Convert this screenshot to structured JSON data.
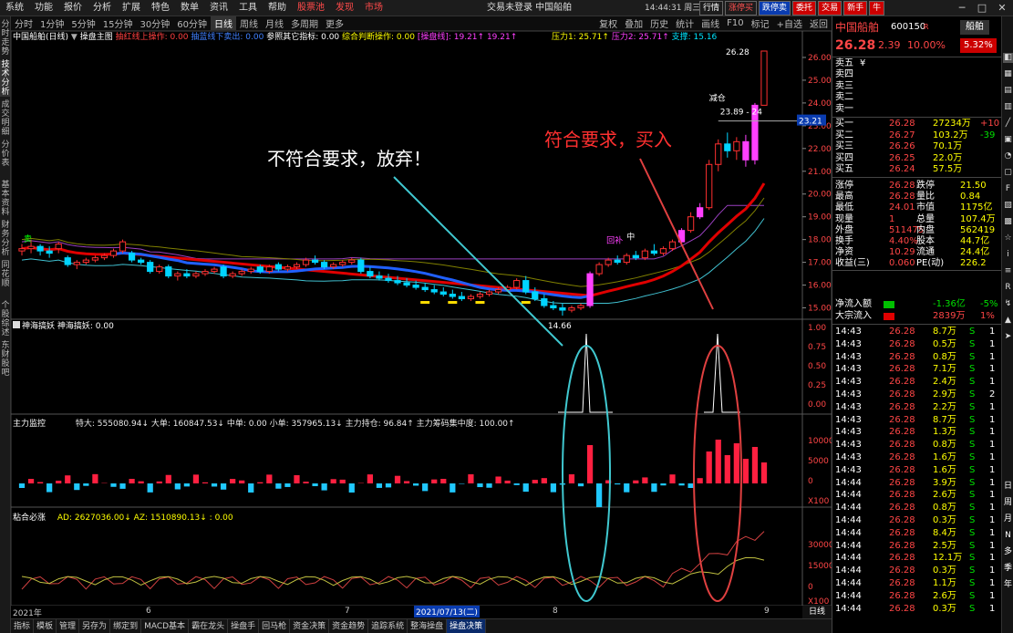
{
  "menubar": {
    "items": [
      "系统",
      "功能",
      "报价",
      "分析",
      "扩展",
      "特色",
      "数单",
      "资讯",
      "工具",
      "帮助"
    ],
    "hot": [
      "股票池",
      "发现",
      "市场"
    ],
    "title": "交易未登录  中国船舶",
    "right_buttons": [
      "行情",
      "涨停买",
      "跌停卖",
      "委托",
      "交易",
      "新手",
      "牛"
    ]
  },
  "left_strip": [
    "分时走势",
    "技术分析",
    "成交明细",
    "分价表",
    "基本资料",
    "财务分析",
    "同花顺",
    "个股综述",
    "东财股吧"
  ],
  "periods": [
    "分时",
    "1分钟",
    "5分钟",
    "15分钟",
    "30分钟",
    "60分钟",
    "日线",
    "周线",
    "月线",
    "多周期",
    "更多"
  ],
  "active_period": "日线",
  "clock": "14:44:31 周三",
  "right_tools": [
    "复权",
    "叠加",
    "历史",
    "统计",
    "画线",
    "F10",
    "标记",
    "+自选",
    "返回"
  ],
  "indicator_line": {
    "stock": "中国船舶(日线)",
    "sep": "▼",
    "a": "操盘主图",
    "b": "抽红线上操作: 0.00",
    "c": "抽蓝线下卖出: 0.00",
    "d": "参照其它指标: 0.00",
    "e": "综合判断操作: 0.00",
    "f": "[操盘线]: 19.21↑",
    "g": "19.21↑",
    "h": "压力1: 25.71↑",
    "i": "压力2: 25.71↑",
    "j": "支撑: 15.16"
  },
  "chart_data": {
    "type": "candlestick",
    "price_axis": [
      "26.00",
      "25.00",
      "24.00",
      "23.00",
      "22.00",
      "21.00",
      "20.00",
      "19.00",
      "18.00",
      "17.00",
      "16.00",
      "15.00"
    ],
    "ylim": [
      14.5,
      26.6
    ],
    "high_label": "26.28",
    "low_label": "14.66",
    "crosshair_value": "23.21",
    "crosshair_label": "23.89 - 24",
    "candles": [
      [
        17.5,
        17.8,
        17.3,
        17.6
      ],
      [
        17.6,
        18.0,
        17.4,
        17.7
      ],
      [
        17.7,
        17.8,
        17.3,
        17.5
      ],
      [
        17.5,
        17.7,
        17.2,
        17.4
      ],
      [
        17.6,
        17.9,
        17.4,
        17.8
      ],
      [
        17.2,
        17.3,
        16.8,
        16.9
      ],
      [
        16.9,
        17.1,
        16.7,
        17.0
      ],
      [
        17.0,
        17.2,
        16.9,
        17.1
      ],
      [
        17.1,
        17.3,
        17.0,
        17.2
      ],
      [
        17.2,
        17.4,
        17.1,
        17.3
      ],
      [
        17.3,
        17.6,
        17.2,
        17.5
      ],
      [
        17.5,
        18.0,
        17.4,
        17.9
      ],
      [
        17.4,
        17.5,
        17.0,
        17.1
      ],
      [
        17.1,
        17.2,
        16.9,
        17.0
      ],
      [
        17.0,
        17.1,
        16.5,
        16.6
      ],
      [
        16.6,
        16.9,
        16.5,
        16.8
      ],
      [
        16.8,
        16.9,
        16.3,
        16.4
      ],
      [
        16.4,
        16.6,
        16.2,
        16.5
      ],
      [
        16.5,
        16.7,
        16.3,
        16.4
      ],
      [
        16.4,
        16.6,
        16.3,
        16.5
      ],
      [
        16.5,
        16.7,
        16.4,
        16.6
      ],
      [
        16.6,
        16.8,
        16.5,
        16.7
      ],
      [
        16.8,
        16.9,
        16.3,
        16.4
      ],
      [
        16.4,
        16.6,
        16.3,
        16.5
      ],
      [
        16.5,
        16.7,
        16.4,
        16.6
      ],
      [
        16.6,
        16.8,
        16.5,
        16.7
      ],
      [
        16.8,
        16.9,
        16.5,
        16.6
      ],
      [
        16.6,
        16.9,
        16.5,
        16.8
      ],
      [
        16.9,
        17.0,
        16.6,
        16.7
      ],
      [
        16.7,
        16.9,
        16.6,
        16.8
      ],
      [
        16.8,
        17.0,
        16.7,
        16.9
      ],
      [
        16.9,
        17.2,
        16.8,
        17.1
      ],
      [
        17.1,
        17.3,
        16.9,
        17.0
      ],
      [
        17.0,
        17.1,
        16.7,
        16.8
      ],
      [
        16.8,
        17.0,
        16.7,
        16.9
      ],
      [
        16.9,
        17.1,
        16.8,
        17.0
      ],
      [
        17.0,
        17.2,
        16.9,
        17.1
      ],
      [
        17.1,
        17.2,
        16.5,
        16.6
      ],
      [
        16.6,
        16.8,
        16.3,
        16.4
      ],
      [
        16.4,
        16.6,
        16.2,
        16.3
      ],
      [
        16.3,
        16.5,
        16.1,
        16.2
      ],
      [
        16.2,
        16.4,
        16.0,
        16.1
      ],
      [
        16.1,
        16.3,
        15.9,
        16.0
      ],
      [
        16.0,
        16.2,
        15.8,
        15.9
      ],
      [
        15.9,
        16.1,
        15.7,
        15.8
      ],
      [
        15.8,
        16.0,
        15.6,
        15.7
      ],
      [
        15.7,
        15.9,
        15.5,
        15.6
      ],
      [
        15.6,
        15.8,
        15.4,
        15.5
      ],
      [
        15.5,
        15.7,
        15.3,
        15.4
      ],
      [
        15.4,
        15.6,
        15.3,
        15.5
      ],
      [
        15.5,
        15.7,
        15.4,
        15.6
      ],
      [
        15.6,
        15.8,
        15.5,
        15.7
      ],
      [
        15.7,
        15.9,
        15.6,
        15.8
      ],
      [
        15.8,
        16.0,
        15.7,
        15.9
      ],
      [
        15.9,
        16.3,
        15.8,
        16.2
      ],
      [
        16.2,
        16.4,
        15.6,
        15.7
      ],
      [
        15.7,
        15.9,
        15.3,
        15.4
      ],
      [
        15.4,
        15.6,
        15.0,
        15.1
      ],
      [
        15.1,
        15.3,
        14.9,
        15.0
      ],
      [
        15.0,
        15.2,
        14.66,
        14.9
      ],
      [
        14.9,
        15.1,
        14.8,
        15.0
      ],
      [
        15.0,
        15.2,
        14.9,
        15.1
      ],
      [
        15.1,
        16.6,
        15.0,
        16.5
      ],
      [
        16.5,
        17.0,
        16.4,
        16.9
      ],
      [
        16.9,
        17.2,
        16.8,
        17.1
      ],
      [
        17.1,
        17.3,
        16.9,
        17.0
      ],
      [
        17.0,
        17.4,
        16.9,
        17.3
      ],
      [
        17.3,
        17.5,
        17.1,
        17.2
      ],
      [
        17.2,
        17.6,
        17.1,
        17.5
      ],
      [
        17.5,
        17.8,
        17.3,
        17.4
      ],
      [
        17.4,
        17.7,
        17.3,
        17.6
      ],
      [
        17.6,
        18.0,
        17.5,
        17.9
      ],
      [
        17.9,
        18.5,
        17.8,
        18.4
      ],
      [
        18.4,
        19.2,
        18.3,
        19.0
      ],
      [
        19.0,
        19.6,
        18.9,
        19.4
      ],
      [
        19.4,
        21.5,
        19.3,
        21.3
      ],
      [
        21.3,
        22.4,
        21.0,
        22.2
      ],
      [
        22.2,
        22.7,
        21.6,
        21.9
      ],
      [
        21.9,
        22.5,
        21.5,
        22.3
      ],
      [
        22.3,
        22.6,
        21.2,
        21.5
      ],
      [
        21.5,
        24.0,
        21.3,
        23.9
      ],
      [
        23.9,
        26.28,
        23.9,
        26.28
      ]
    ],
    "bull_markers": [
      62,
      72,
      74,
      79,
      80
    ],
    "boll_upper": "purple",
    "sub1": {
      "title": "神海搞妖",
      "subtitle": "神海搞妖: 0.00",
      "axis": [
        "1.00",
        "0.75",
        "0.50",
        "0.25",
        "0.00"
      ]
    },
    "sub2": {
      "title": "主力监控",
      "values": "特大: 555080.94↓  大单: 160847.53↓  中单: 0.00  小单: 357965.13↓  主力持仓: 96.84↑  主力筹码集中度: 100.00↑",
      "axis": [
        "10000",
        "5000",
        "0"
      ],
      "unit": "X100"
    },
    "sub3": {
      "title": "粘合必涨",
      "values": "AD: 2627036.00↓  AZ: 1510890.13↓  : 0.00",
      "axis": [
        "30000",
        "15000",
        "0"
      ],
      "unit": "X100"
    },
    "dates": [
      "2021年",
      "6",
      "7",
      "2021/07/13(二)",
      "8",
      "9"
    ],
    "markers": {
      "sell": "卖",
      "jian": "减仓",
      "jian2": "减仓",
      "huibu": "回补",
      "zhong": "中"
    },
    "annotations": {
      "left": "不符合要求，放弃！",
      "right": "符合要求，买入"
    }
  },
  "quote": {
    "name": "中国船舶",
    "code": "600150",
    "flag": "R",
    "badge": "船舶",
    "price": "26.28",
    "change": "2.39",
    "pct": "10.00%",
    "badge2": "5.32%",
    "sells": [
      [
        "卖五",
        "",
        ""
      ],
      [
        "卖四",
        "",
        ""
      ],
      [
        "卖三",
        "",
        ""
      ],
      [
        "卖二",
        "",
        ""
      ],
      [
        "卖一",
        "",
        ""
      ]
    ],
    "buys": [
      [
        "买一",
        "26.28",
        "27234万",
        "+10"
      ],
      [
        "买二",
        "26.27",
        "103.2万",
        "-39"
      ],
      [
        "买三",
        "26.26",
        "70.1万",
        ""
      ],
      [
        "买四",
        "26.25",
        "22.0万",
        ""
      ],
      [
        "买五",
        "26.24",
        "57.5万",
        ""
      ]
    ],
    "stats": [
      [
        "涨停",
        "26.28",
        "跌停",
        "21.50"
      ],
      [
        "最高",
        "26.28",
        "量比",
        "0.84"
      ],
      [
        "最低",
        "24.01",
        "市值",
        "1175亿"
      ],
      [
        "现量",
        "1",
        "总量",
        "107.4万"
      ],
      [
        "外盘",
        "511475",
        "内盘",
        "562419"
      ],
      [
        "换手",
        "4.40%",
        "股本",
        "44.7亿"
      ],
      [
        "净资",
        "10.29",
        "流通",
        "24.4亿"
      ],
      [
        "收益(三)",
        "0.060",
        "PE(动)",
        "226.2"
      ]
    ],
    "flow": [
      [
        "净流入额",
        "-1.36亿",
        "-5%"
      ],
      [
        "大宗流入",
        "2839万",
        "1%"
      ]
    ],
    "ticks": [
      [
        "14:43",
        "26.28",
        "8.7万",
        "S",
        "1"
      ],
      [
        "14:43",
        "26.28",
        "0.5万",
        "S",
        "1"
      ],
      [
        "14:43",
        "26.28",
        "0.8万",
        "S",
        "1"
      ],
      [
        "14:43",
        "26.28",
        "7.1万",
        "S",
        "1"
      ],
      [
        "14:43",
        "26.28",
        "2.4万",
        "S",
        "1"
      ],
      [
        "14:43",
        "26.28",
        "2.9万",
        "S",
        "2"
      ],
      [
        "14:43",
        "26.28",
        "2.2万",
        "S",
        "1"
      ],
      [
        "14:43",
        "26.28",
        "8.7万",
        "S",
        "1"
      ],
      [
        "14:43",
        "26.28",
        "1.3万",
        "S",
        "1"
      ],
      [
        "14:43",
        "26.28",
        "0.8万",
        "S",
        "1"
      ],
      [
        "14:43",
        "26.28",
        "1.6万",
        "S",
        "1"
      ],
      [
        "14:43",
        "26.28",
        "1.6万",
        "S",
        "1"
      ],
      [
        "14:44",
        "26.28",
        "3.9万",
        "S",
        "1"
      ],
      [
        "14:44",
        "26.28",
        "2.6万",
        "S",
        "1"
      ],
      [
        "14:44",
        "26.28",
        "0.8万",
        "S",
        "1"
      ],
      [
        "14:44",
        "26.28",
        "0.3万",
        "S",
        "1"
      ],
      [
        "14:44",
        "26.28",
        "8.4万",
        "S",
        "1"
      ],
      [
        "14:44",
        "26.28",
        "2.5万",
        "S",
        "1"
      ],
      [
        "14:44",
        "26.28",
        "12.1万",
        "S",
        "1"
      ],
      [
        "14:44",
        "26.28",
        "0.3万",
        "S",
        "1"
      ],
      [
        "14:44",
        "26.28",
        "1.1万",
        "S",
        "1"
      ],
      [
        "14:44",
        "26.28",
        "2.6万",
        "S",
        "1"
      ],
      [
        "14:44",
        "26.28",
        "0.3万",
        "S",
        "1"
      ]
    ]
  },
  "bottom_tabs": [
    "指标",
    "模板",
    "管理",
    "另存为",
    "绑定到",
    "MACD基本",
    "霸在龙头",
    "操盘手",
    "回马枪",
    "资金决策",
    "资金趋势",
    "追踪系统",
    "整海操盘",
    "操盘决策"
  ],
  "chart_corner": "日线",
  "colors": {
    "up": "#ff3030",
    "down": "#00d4ff",
    "bull": "#ff40ff",
    "ma_red": "#e00000",
    "ma_blue": "#2060ff"
  }
}
